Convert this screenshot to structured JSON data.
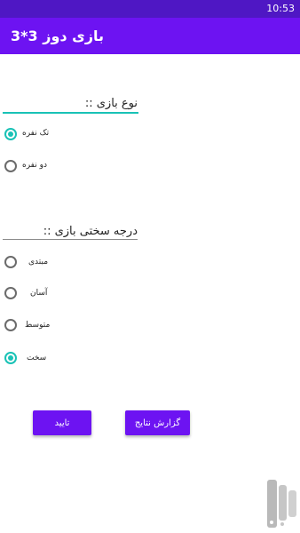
{
  "status_bar": {
    "time": "10:53",
    "background": "#4f17c4"
  },
  "app_bar": {
    "title": "بازی دوز 3*3",
    "background": "#6d13f2"
  },
  "game_type": {
    "title": "نوع بازی ::",
    "options": [
      {
        "label": "تک نفره",
        "checked": true
      },
      {
        "label": "دو نفره",
        "checked": false
      }
    ]
  },
  "difficulty": {
    "title": "درجه سختی بازی ::",
    "options": [
      {
        "label": "مبتدی",
        "checked": false
      },
      {
        "label": "آسان",
        "checked": false
      },
      {
        "label": "متوسط",
        "checked": false
      },
      {
        "label": "سخت",
        "checked": true
      }
    ]
  },
  "buttons": {
    "confirm": "تایید",
    "report": "گزارش نتایج"
  },
  "colors": {
    "accent": "#19c2b6",
    "primary": "#6d13f2",
    "primary_dark": "#4f17c4"
  },
  "logo": {
    "text": "بازار"
  }
}
